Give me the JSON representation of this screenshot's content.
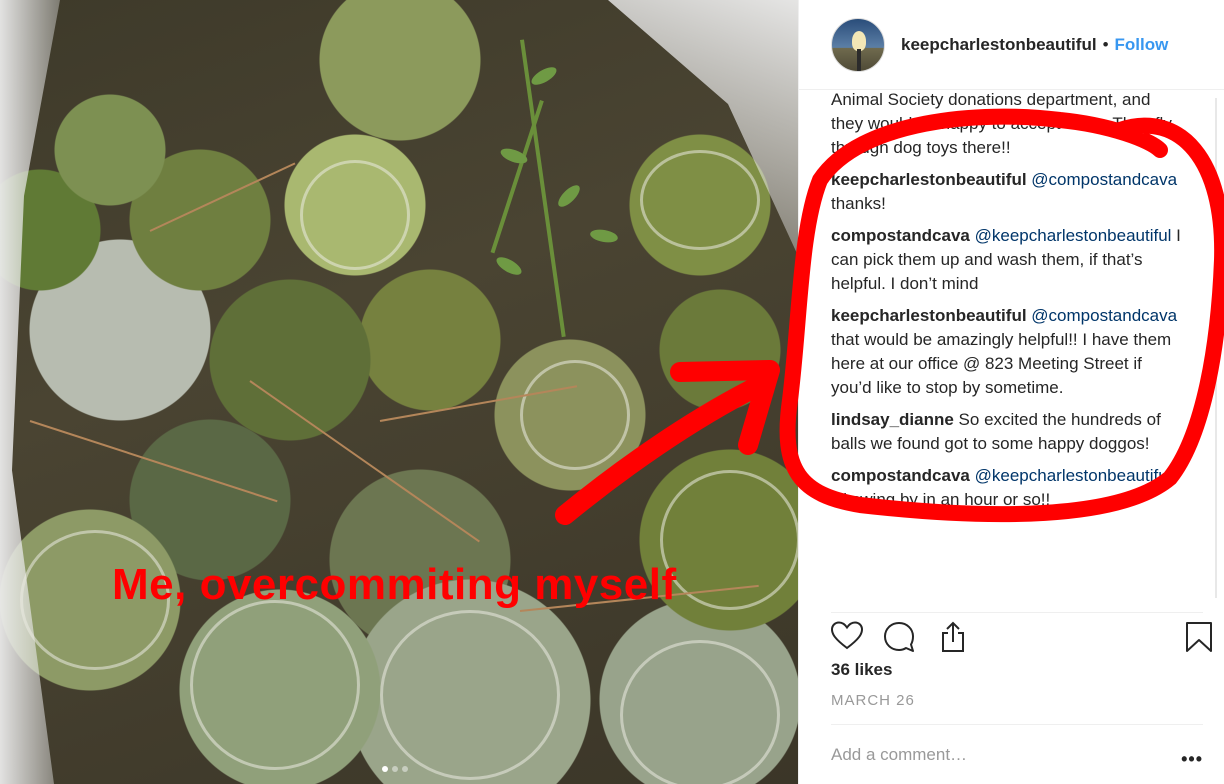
{
  "photo": {
    "caption": "Me, overcommiting myself",
    "carousel_dots": 3,
    "carousel_active": 1
  },
  "post": {
    "username": "keepcharlestonbeautiful",
    "separator": "•",
    "follow_label": "Follow",
    "comments": [
      {
        "user": "",
        "mention": "",
        "text": "Animal Society donations department, and they would be happy to accept them. They fly through dog toys there!!"
      },
      {
        "user": "keepcharlestonbeautiful",
        "mention": "@compostandcava",
        "text": " thanks!"
      },
      {
        "user": "compostandcava",
        "mention": "@keepcharlestonbeautiful",
        "text": " I can pick them up and wash them, if that’s helpful. I don’t mind"
      },
      {
        "user": "keepcharlestonbeautiful",
        "mention": "@compostandcava",
        "text": " that would be amazingly helpful!! I have them here at our office @ 823 Meeting Street if you’d like to stop by sometime."
      },
      {
        "user": "lindsay_dianne",
        "mention": "",
        "text": " So excited the hundreds of balls we found got to some happy doggos!"
      },
      {
        "user": "compostandcava",
        "mention": "@keepcharlestonbeautiful",
        "text": " I’ll swing by in an hour or so!!"
      }
    ],
    "likes": "36 likes",
    "date": "MARCH 26",
    "add_comment_placeholder": "Add a comment…",
    "more_label": "•••"
  },
  "icons": {
    "like": "heart-icon",
    "comment": "comment-bubble-icon",
    "share": "share-icon",
    "save": "bookmark-icon"
  },
  "colors": {
    "caption_red": "#ff0000",
    "follow_blue": "#3897f0",
    "mention_blue": "#003569",
    "muted_gray": "#999999"
  }
}
